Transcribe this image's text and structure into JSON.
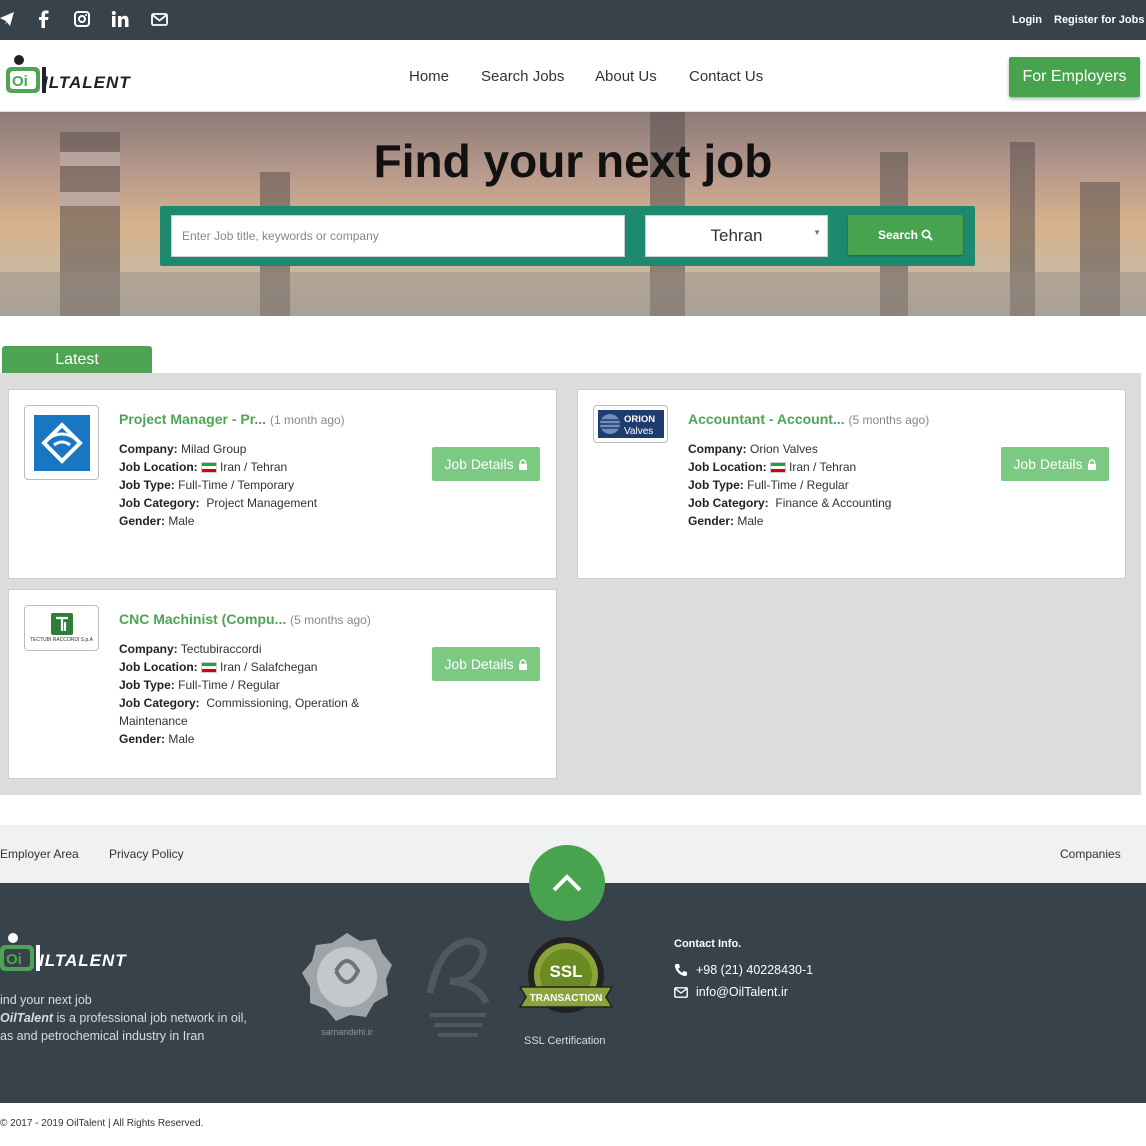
{
  "topbar": {
    "social_icons": [
      "telegram-icon",
      "facebook-icon",
      "instagram-icon",
      "linkedin-icon",
      "email-icon"
    ],
    "login": "Login",
    "register": "Register for Jobs"
  },
  "brand": {
    "logo_text": "ILTALENT"
  },
  "nav": {
    "items": [
      "Home",
      "Search Jobs",
      "About Us",
      "Contact Us"
    ],
    "employers": "For Employers"
  },
  "hero": {
    "title": "Find your next job",
    "search_placeholder": "Enter Job title, keywords or company",
    "city": "Tehran",
    "search_label": "Search"
  },
  "latest_tab": "Latest",
  "jobs": [
    {
      "title": "Project Manager - Pr...",
      "ago": "(1 month ago)",
      "company": "Milad Group",
      "location": "Iran / Tehran",
      "type": "Full-Time / Temporary",
      "category": "Project Management",
      "gender": "Male",
      "details": "Job Details"
    },
    {
      "title": "Accountant - Account...",
      "ago": "(5 months ago)",
      "company": "Orion Valves",
      "location": "Iran / Tehran",
      "type": "Full-Time / Regular",
      "category": "Finance & Accounting",
      "gender": "Male",
      "details": "Job Details"
    },
    {
      "title": "CNC Machinist (Compu...",
      "ago": "(5 months ago)",
      "company": "Tectubiraccordi",
      "location": "Iran / Salafchegan",
      "type": "Full-Time / Regular",
      "category": "Commissioning, Operation & Maintenance",
      "gender": "Male",
      "details": "Job Details"
    }
  ],
  "labels": {
    "company": "Company:",
    "location": "Job Location:",
    "type": "Job Type:",
    "category": "Job Category:",
    "gender": "Gender:"
  },
  "logos": {
    "orion_top": "ORION",
    "orion_bottom": "Valves",
    "tectubi": "TECTUBI RACCORDI S.p.A"
  },
  "footer": {
    "links": [
      "Employer Area",
      "Privacy Policy"
    ],
    "companies": "Companies",
    "tagline": "ind your next job",
    "desc_brand": "OilTalent",
    "desc_rest": " is a professional job network in oil, as and petrochemical industry in Iran",
    "samandehi": "samandehi.ir",
    "ssl_label": "SSL Certification",
    "ssl_text": "SSL",
    "ssl_sub": "TRANSACTION",
    "contact_title": "Contact Info.",
    "phone": "+98 (21) 40228430-1",
    "email": "info@OilTalent.ir",
    "copyright": "© 2017 - 2019 OilTalent | All Rights Reserved."
  }
}
